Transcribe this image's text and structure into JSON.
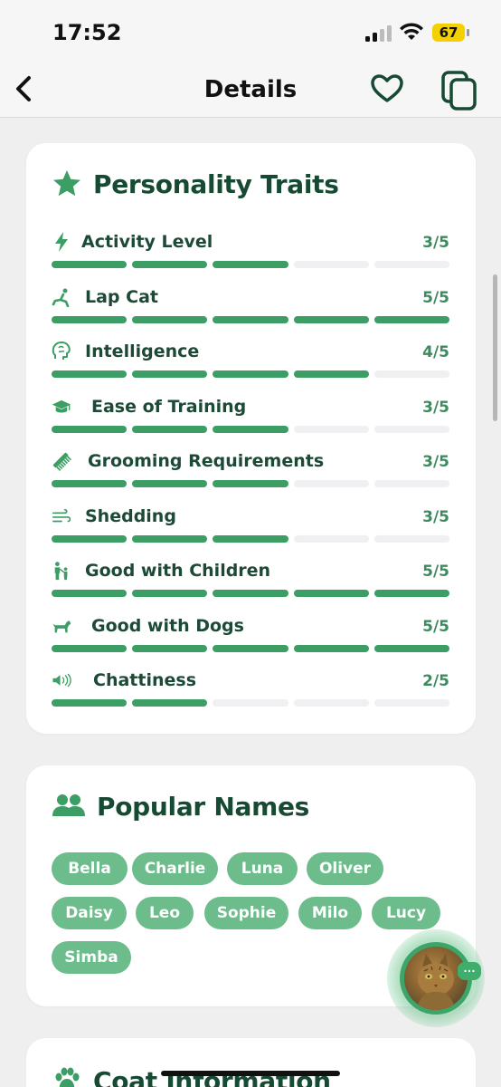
{
  "status": {
    "time": "17:52",
    "battery": "67"
  },
  "nav": {
    "title": "Details"
  },
  "colors": {
    "accent": "#3c9e64",
    "chip": "#6dbc8b",
    "dark_green": "#174a33",
    "track": "#f0f0f3"
  },
  "personality": {
    "title": "Personality Traits",
    "title_icon": "star-icon",
    "traits": [
      {
        "label": "Activity Level",
        "score": "3/5",
        "value": 3,
        "icon": "lightning-icon"
      },
      {
        "label": "Lap Cat",
        "score": "5/5",
        "value": 5,
        "icon": "recline-icon"
      },
      {
        "label": "Intelligence",
        "score": "4/5",
        "value": 4,
        "icon": "brain-icon"
      },
      {
        "label": "Ease of Training",
        "score": "3/5",
        "value": 3,
        "icon": "graduation-cap-icon"
      },
      {
        "label": "Grooming Requirements",
        "score": "3/5",
        "value": 3,
        "icon": "comb-icon"
      },
      {
        "label": "Shedding",
        "score": "3/5",
        "value": 3,
        "icon": "wind-icon"
      },
      {
        "label": "Good with Children",
        "score": "5/5",
        "value": 5,
        "icon": "child-icon"
      },
      {
        "label": "Good with Dogs",
        "score": "5/5",
        "value": 5,
        "icon": "dog-icon"
      },
      {
        "label": "Chattiness",
        "score": "2/5",
        "value": 2,
        "icon": "speaker-icon"
      }
    ],
    "max": 5
  },
  "names": {
    "title": "Popular Names",
    "title_icon": "users-icon",
    "items": [
      "Bella",
      "Charlie",
      "Luna",
      "Oliver",
      "Daisy",
      "Leo",
      "Sophie",
      "Milo",
      "Lucy",
      "Simba"
    ]
  },
  "coat": {
    "title": "Coat Information",
    "title_icon": "paw-icon"
  },
  "fab": {
    "chat_glyph": "…"
  }
}
